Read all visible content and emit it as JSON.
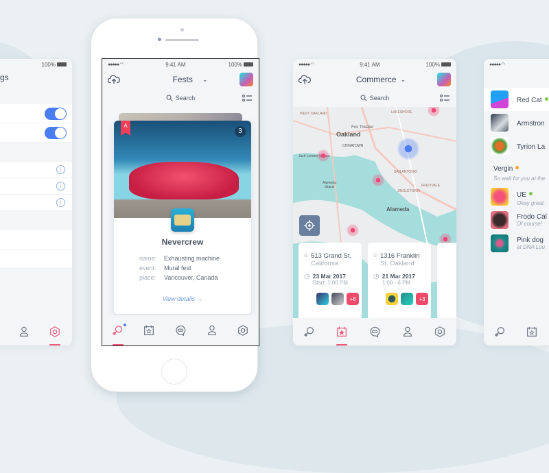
{
  "settings_screen": {
    "status": {
      "battery": "100%"
    },
    "title_fragment": "gs",
    "toggles": [
      true,
      true
    ],
    "info_rows": 3,
    "tabbar": [
      "profile",
      "settings"
    ]
  },
  "fests_screen": {
    "status": {
      "time": "9:41 AM",
      "battery": "100%"
    },
    "header": {
      "title": "Fests"
    },
    "search": {
      "placeholder": "Search"
    },
    "card": {
      "badge": "A",
      "count": "3",
      "artist": "Nevercrew",
      "fields": [
        {
          "key": "name:",
          "value": "Exhausting machine"
        },
        {
          "key": "event:",
          "value": "Mural fest"
        },
        {
          "key": "place:",
          "value": "Vancouver, Canada"
        }
      ],
      "view_details": "View details →"
    },
    "tabbar": {
      "active": "explore",
      "items": [
        "explore",
        "events",
        "chat",
        "profile",
        "settings"
      ]
    }
  },
  "commerce_screen": {
    "status": {
      "time": "9:41 AM",
      "battery": "100%"
    },
    "header": {
      "title": "Commerce"
    },
    "search": {
      "placeholder": "Search"
    },
    "map_labels": [
      "WEST OAKLAND",
      "LAKESHORE",
      "Fox Theater",
      "Oakland",
      "CHINATOWN",
      "Jack London Square",
      "SAN ANTONIO",
      "Alameda Island",
      "JINGLETOWN",
      "FRUITVALE",
      "Alameda"
    ],
    "locations": [
      {
        "address1": "513 Grand St,",
        "address2": "California",
        "date": "23 Mar 2017",
        "time": "Start: 1:00 PM",
        "extra": "+8"
      },
      {
        "address1": "1316 Franklin",
        "address2": "St, Oakland",
        "date": "21 Mar 2017",
        "time": "1:00 - 6 PM",
        "extra": "+3"
      }
    ],
    "tabbar": {
      "active": "events",
      "items": [
        "explore",
        "events",
        "chat",
        "profile",
        "settings"
      ]
    }
  },
  "chat_screen": {
    "contacts": [
      {
        "name": "Red Cat",
        "status": "online",
        "message": ""
      },
      {
        "name": "Armstron",
        "status": "",
        "message": ""
      },
      {
        "name": "Tyrion La",
        "status": "",
        "message": ""
      },
      {
        "name": "Vergin",
        "status": "away",
        "message": "So wait for you at the"
      },
      {
        "name": "UE",
        "status": "online",
        "message": "Okay great."
      },
      {
        "name": "Frodo Cal",
        "status": "",
        "message": "Of course!"
      },
      {
        "name": "Pink dog",
        "status": "",
        "message": "at DNA Lou"
      }
    ]
  },
  "colors": {
    "accent": "#f0587a",
    "blue": "#4a7cf2",
    "online": "#7bc84a",
    "away": "#f5a53a"
  }
}
